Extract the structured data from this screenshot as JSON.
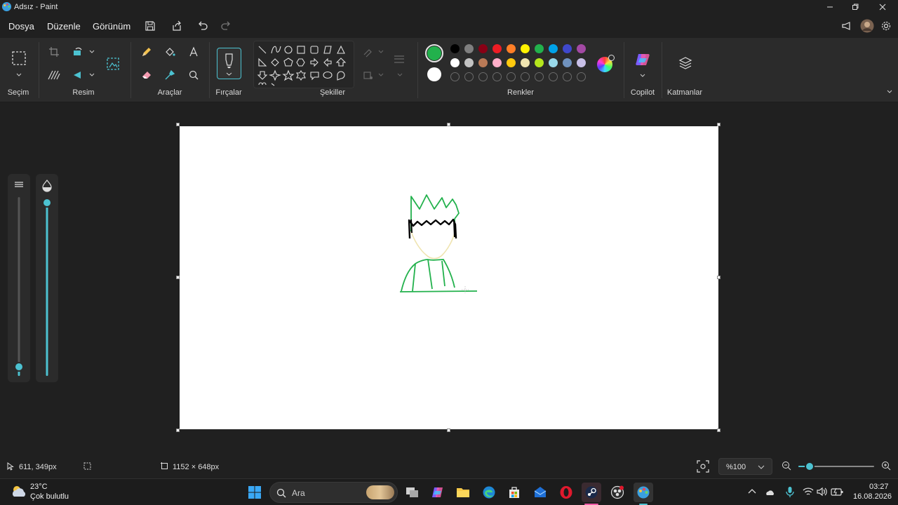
{
  "window": {
    "title": "Adsız - Paint"
  },
  "menu": {
    "file": "Dosya",
    "edit": "Düzenle",
    "view": "Görünüm"
  },
  "ribbon": {
    "groups": {
      "selection": "Seçim",
      "image": "Resim",
      "tools": "Araçlar",
      "brushes": "Fırçalar",
      "shapes": "Şekiller",
      "colors": "Renkler",
      "copilot": "Copilot",
      "layers": "Katmanlar"
    },
    "palette_row1": [
      "#000000",
      "#7f7f7f",
      "#880015",
      "#ed1c24",
      "#ff7f27",
      "#fff200",
      "#22b14c",
      "#00a2e8",
      "#3f48cc",
      "#a349a4"
    ],
    "palette_row2": [
      "#ffffff",
      "#c3c3c3",
      "#b97a57",
      "#ffaec9",
      "#ffc90e",
      "#efe4b0",
      "#b5e61d",
      "#99d9ea",
      "#7092be",
      "#c8bfe7"
    ],
    "primary_color": "#22b14c",
    "secondary_color": "#ffffff"
  },
  "status": {
    "cursor_pos": "611, 349px",
    "canvas_size": "1152 × 648px",
    "zoom": "%100"
  },
  "taskbar": {
    "weather_temp": "23°C",
    "weather_desc": "Çok bulutlu",
    "search_placeholder": "Ara",
    "time": "03:27",
    "date": "16.08.2026"
  },
  "colors": {
    "accent": "#4cc2d1",
    "background": "#202020",
    "ribbon": "#2b2b2b"
  }
}
